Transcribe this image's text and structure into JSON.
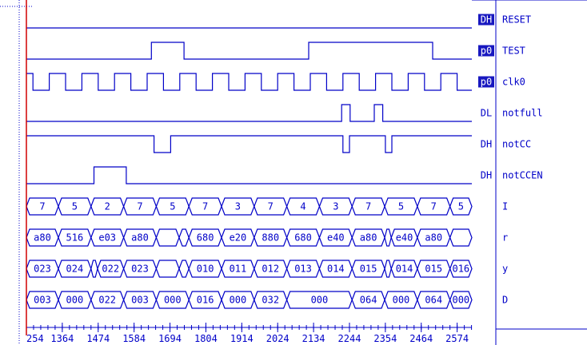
{
  "colors": {
    "wave": "#0000c8",
    "cursor": "#d00000",
    "background": "#ffffff",
    "badge_bg": "#1818c0",
    "badge_fg": "#ffffff"
  },
  "signals": [
    {
      "badge": "DH",
      "badge_highlighted": true,
      "name": "RESET",
      "kind": "bit",
      "init": 0,
      "toggles": []
    },
    {
      "badge": "p0",
      "badge_highlighted": true,
      "name": "TEST",
      "kind": "bit",
      "init": 0,
      "toggles": [
        1637,
        1737,
        2119,
        2499
      ]
    },
    {
      "badge": "p0",
      "badge_highlighted": true,
      "name": "clk0",
      "kind": "clock",
      "init": 1,
      "period": 50,
      "first": 1274
    },
    {
      "badge": "DL",
      "badge_highlighted": false,
      "name": "notfull",
      "kind": "bit",
      "init": 0,
      "toggles": [
        2220,
        2246,
        2320,
        2346
      ]
    },
    {
      "badge": "DH",
      "badge_highlighted": false,
      "name": "notCC",
      "kind": "bit",
      "init": 1,
      "toggles": [
        1645,
        1696,
        2224,
        2244,
        2354,
        2374
      ]
    },
    {
      "badge": "DH",
      "badge_highlighted": false,
      "name": "notCCEN",
      "kind": "bit",
      "init": 0,
      "toggles": [
        1461,
        1560
      ]
    },
    {
      "badge": "",
      "badge_highlighted": false,
      "name": "I",
      "kind": "bus",
      "segments": [
        {
          "start": 1254,
          "end": 1352,
          "label": "7"
        },
        {
          "start": 1352,
          "end": 1452,
          "label": "5"
        },
        {
          "start": 1452,
          "end": 1552,
          "label": "2"
        },
        {
          "start": 1552,
          "end": 1652,
          "label": "7"
        },
        {
          "start": 1652,
          "end": 1752,
          "label": "5"
        },
        {
          "start": 1752,
          "end": 1852,
          "label": "7"
        },
        {
          "start": 1852,
          "end": 1952,
          "label": "3"
        },
        {
          "start": 1952,
          "end": 2052,
          "label": "7"
        },
        {
          "start": 2052,
          "end": 2152,
          "label": "4"
        },
        {
          "start": 2152,
          "end": 2252,
          "label": "3"
        },
        {
          "start": 2252,
          "end": 2352,
          "label": "7"
        },
        {
          "start": 2352,
          "end": 2452,
          "label": "5"
        },
        {
          "start": 2452,
          "end": 2552,
          "label": "7"
        },
        {
          "start": 2552,
          "end": 2619,
          "label": "5"
        }
      ]
    },
    {
      "badge": "",
      "badge_highlighted": false,
      "name": "r",
      "kind": "bus",
      "segments": [
        {
          "start": 1254,
          "end": 1352,
          "label": "a80"
        },
        {
          "start": 1352,
          "end": 1452,
          "label": "516"
        },
        {
          "start": 1452,
          "end": 1552,
          "label": "e03"
        },
        {
          "start": 1552,
          "end": 1652,
          "label": "a80"
        },
        {
          "start": 1652,
          "end": 1722,
          "label": ""
        },
        {
          "start": 1722,
          "end": 1752,
          "label": ""
        },
        {
          "start": 1752,
          "end": 1852,
          "label": "680"
        },
        {
          "start": 1852,
          "end": 1952,
          "label": "e20"
        },
        {
          "start": 1952,
          "end": 2052,
          "label": "880"
        },
        {
          "start": 2052,
          "end": 2152,
          "label": "680"
        },
        {
          "start": 2152,
          "end": 2252,
          "label": "e40"
        },
        {
          "start": 2252,
          "end": 2352,
          "label": "a80"
        },
        {
          "start": 2352,
          "end": 2372,
          "label": ""
        },
        {
          "start": 2372,
          "end": 2452,
          "label": "e40"
        },
        {
          "start": 2452,
          "end": 2552,
          "label": "a80"
        },
        {
          "start": 2552,
          "end": 2619,
          "label": ""
        }
      ]
    },
    {
      "badge": "",
      "badge_highlighted": false,
      "name": "y",
      "kind": "bus",
      "segments": [
        {
          "start": 1254,
          "end": 1352,
          "label": "023"
        },
        {
          "start": 1352,
          "end": 1452,
          "label": "024"
        },
        {
          "start": 1452,
          "end": 1472,
          "label": ""
        },
        {
          "start": 1472,
          "end": 1552,
          "label": "022"
        },
        {
          "start": 1552,
          "end": 1652,
          "label": "023"
        },
        {
          "start": 1652,
          "end": 1722,
          "label": ""
        },
        {
          "start": 1722,
          "end": 1752,
          "label": ""
        },
        {
          "start": 1752,
          "end": 1852,
          "label": "010"
        },
        {
          "start": 1852,
          "end": 1952,
          "label": "011"
        },
        {
          "start": 1952,
          "end": 2052,
          "label": "012"
        },
        {
          "start": 2052,
          "end": 2152,
          "label": "013"
        },
        {
          "start": 2152,
          "end": 2252,
          "label": "014"
        },
        {
          "start": 2252,
          "end": 2352,
          "label": "015"
        },
        {
          "start": 2352,
          "end": 2372,
          "label": ""
        },
        {
          "start": 2372,
          "end": 2452,
          "label": "014"
        },
        {
          "start": 2452,
          "end": 2552,
          "label": "015"
        },
        {
          "start": 2552,
          "end": 2619,
          "label": "016"
        }
      ]
    },
    {
      "badge": "",
      "badge_highlighted": false,
      "name": "D",
      "kind": "bus",
      "segments": [
        {
          "start": 1254,
          "end": 1352,
          "label": "003"
        },
        {
          "start": 1352,
          "end": 1452,
          "label": "000"
        },
        {
          "start": 1452,
          "end": 1552,
          "label": "022"
        },
        {
          "start": 1552,
          "end": 1652,
          "label": "003"
        },
        {
          "start": 1652,
          "end": 1752,
          "label": "000"
        },
        {
          "start": 1752,
          "end": 1852,
          "label": "016"
        },
        {
          "start": 1852,
          "end": 1952,
          "label": "000"
        },
        {
          "start": 1952,
          "end": 2052,
          "label": "032"
        },
        {
          "start": 2052,
          "end": 2252,
          "label": "000"
        },
        {
          "start": 2252,
          "end": 2352,
          "label": "064"
        },
        {
          "start": 2352,
          "end": 2452,
          "label": "000"
        },
        {
          "start": 2452,
          "end": 2552,
          "label": "064"
        },
        {
          "start": 2552,
          "end": 2619,
          "label": "000"
        }
      ]
    }
  ],
  "time_axis": {
    "start": 1254,
    "end": 2619,
    "tick_labels": [
      "254",
      "1364",
      "1474",
      "1584",
      "1694",
      "1804",
      "1914",
      "2024",
      "2134",
      "2244",
      "2354",
      "2464",
      "2574"
    ],
    "tick_values": [
      1254,
      1364,
      1474,
      1584,
      1694,
      1804,
      1914,
      2024,
      2134,
      2244,
      2354,
      2464,
      2574
    ],
    "minor_step": 22
  },
  "cursor": {
    "time": 1254
  }
}
